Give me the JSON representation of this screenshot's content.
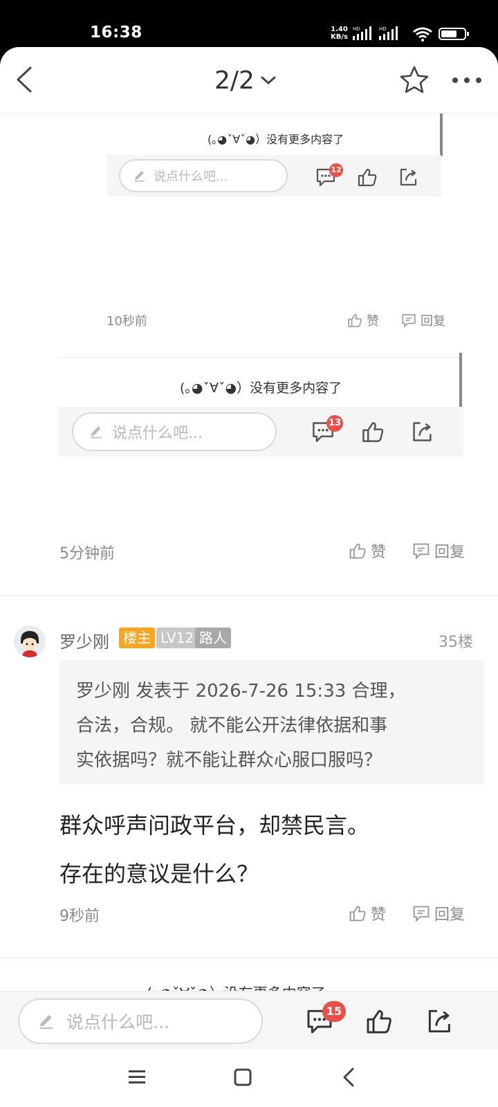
{
  "status_bar": {
    "time": "16:38",
    "net_speed_value": "1.40",
    "net_speed_unit": "KB/s",
    "hd1": "HD",
    "hd2": "HD"
  },
  "header": {
    "page_indicator": "2/2"
  },
  "thread": {
    "nested_preview_small": {
      "no_more": "(｡◕ˇ∀ˇ◕）没有更多内容了",
      "input_placeholder": "说点什么吧...",
      "comment_badge": "12"
    },
    "reply_small": {
      "time": "10秒前",
      "like": "赞",
      "reply": "回复"
    },
    "nested_preview_medium": {
      "no_more": "(｡◕ˇ∀ˇ◕）没有更多内容了",
      "input_placeholder": "说点什么吧...",
      "comment_badge": "13"
    },
    "reply_medium": {
      "time": "5分钟前",
      "like": "赞",
      "reply": "回复"
    },
    "post": {
      "username": "罗少刚",
      "tag_owner": "楼主",
      "tag_level": "LV12",
      "tag_title": "路人",
      "floor": "35楼",
      "quote_line1": "罗少刚 发表于 2026-7-26 15:33 合理，",
      "quote_line2": "合法，合规。 就不能公开法律依据和事",
      "quote_line3": "实依据吗？就不能让群众心服口服吗？",
      "body_line1": "群众呼声问政平台，却禁民言。",
      "body_line2": "存在的意议是什么？",
      "time": "9秒前",
      "like": "赞",
      "reply": "回复"
    },
    "end_text": "(｡◕ˇ∀ˇ◕）没有更多内容了"
  },
  "bottom_bar": {
    "input_placeholder": "说点什么吧...",
    "comment_badge": "15"
  },
  "colors": {
    "tag_owner": "#f5a623",
    "tag_level": "#c7c7c7",
    "tag_title": "#a8a8a8",
    "badge": "#e8504a"
  }
}
